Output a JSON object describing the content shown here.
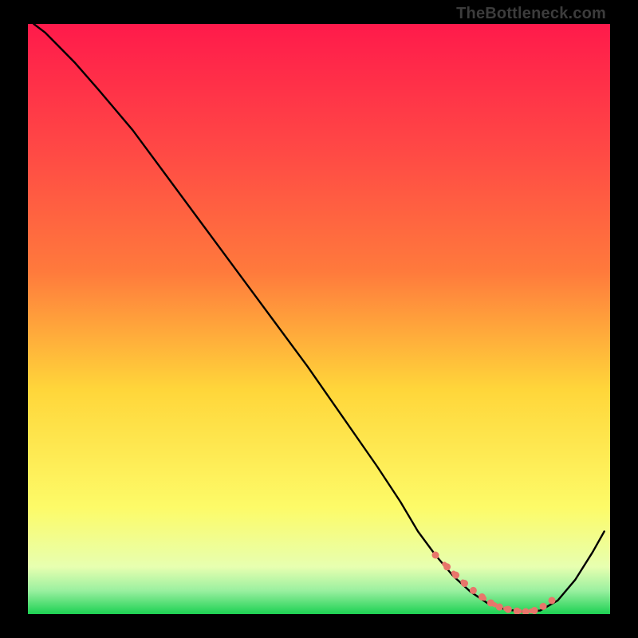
{
  "watermark": "TheBottleneck.com",
  "colors": {
    "gradient_top": "#ff1a4b",
    "gradient_mid1": "#ff7a3c",
    "gradient_mid2": "#ffd63a",
    "gradient_mid3": "#fdfb68",
    "gradient_bottom_band": "#e7ffb0",
    "gradient_green": "#1dd153",
    "curve": "#000000",
    "marker_fill": "#e8766b",
    "marker_stroke": "#e8766b"
  },
  "chart_data": {
    "type": "line",
    "title": "",
    "xlabel": "",
    "ylabel": "",
    "xlim": [
      0,
      100
    ],
    "ylim": [
      0,
      100
    ],
    "series": [
      {
        "name": "bottleneck-curve",
        "x": [
          1,
          3,
          5,
          8,
          12,
          18,
          24,
          30,
          36,
          42,
          48,
          54,
          60,
          64,
          67,
          70,
          73,
          76,
          79,
          82,
          85,
          88,
          91,
          94,
          97,
          99
        ],
        "y": [
          100,
          98.5,
          96.5,
          93.5,
          89,
          82,
          74,
          66,
          58,
          50,
          42,
          33.5,
          25,
          19,
          14,
          10,
          6.5,
          3.8,
          1.8,
          0.8,
          0.4,
          0.6,
          2.3,
          5.8,
          10.5,
          14
        ]
      }
    ],
    "markers": {
      "name": "highlight-region",
      "x": [
        70,
        72,
        73.5,
        75,
        76.5,
        78,
        79.5,
        81,
        82.5,
        84,
        85.5,
        87,
        88.5,
        90
      ],
      "y": [
        10,
        8,
        6.6,
        5.2,
        4.0,
        2.9,
        1.9,
        1.2,
        0.8,
        0.5,
        0.4,
        0.6,
        1.3,
        2.3
      ]
    }
  }
}
